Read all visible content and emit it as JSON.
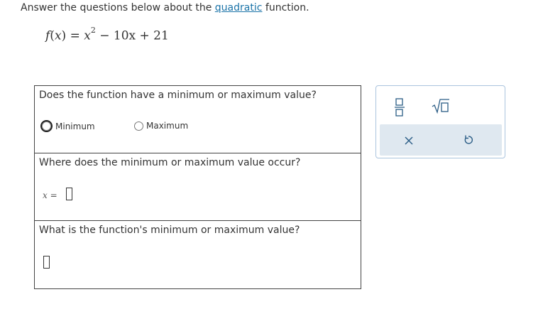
{
  "instruction": {
    "prefix": "Answer the questions below about the ",
    "link": "quadratic",
    "suffix": " function."
  },
  "function": {
    "name": "f",
    "var": "x",
    "equals": " = ",
    "base": "x",
    "exponent": "2",
    "rest": " − 10x + 21"
  },
  "questions": {
    "q1": {
      "text": "Does the function have a minimum or maximum value?",
      "option_min": "Minimum",
      "option_max": "Maximum"
    },
    "q2": {
      "text": "Where does the minimum or maximum value occur?",
      "var_label": "x",
      "equals": " ="
    },
    "q3": {
      "text": "What is the function's minimum or maximum value?"
    }
  },
  "palette": {
    "icons": [
      "fraction-icon",
      "sqrt-icon",
      "close-icon",
      "undo-icon"
    ],
    "colors": {
      "border": "#aac4de",
      "bar": "#dfe8f0",
      "icon": "#2b5d86"
    }
  }
}
